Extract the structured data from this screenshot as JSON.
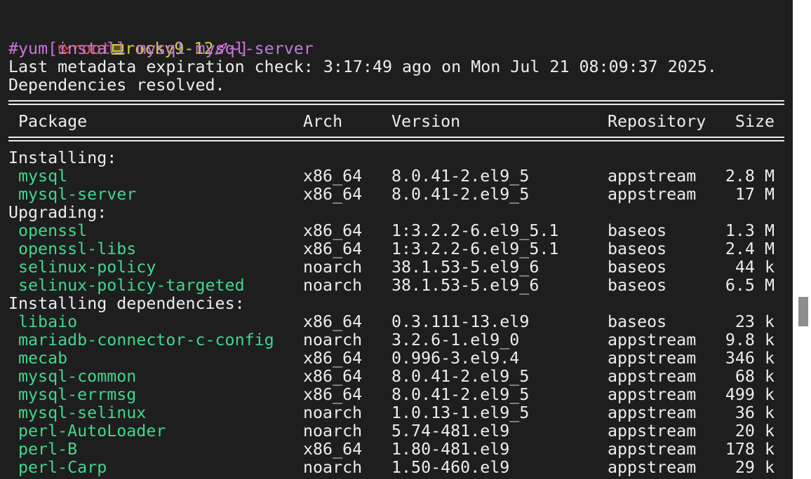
{
  "prompt": {
    "open_bracket": "[",
    "user": "root",
    "host": "rocky9-12",
    "path": "~",
    "close_bracket": "]",
    "user_icon": "crown-icon",
    "host_icon": "computer-icon",
    "path_icon": "rocket-icon"
  },
  "command": "#yum install mysql mysql-server",
  "output_lines": [
    "Last metadata expiration check: 3:17:49 ago on Mon Jul 21 08:09:37 2025.",
    "Dependencies resolved."
  ],
  "table": {
    "headers": {
      "package": "Package",
      "arch": "Arch",
      "version": "Version",
      "repository": "Repository",
      "size": "Size"
    },
    "sections": [
      {
        "title": "Installing:",
        "rows": [
          {
            "name": "mysql",
            "arch": "x86_64",
            "version": "8.0.41-2.el9_5",
            "repo": "appstream",
            "size": "2.8 M"
          },
          {
            "name": "mysql-server",
            "arch": "x86_64",
            "version": "8.0.41-2.el9_5",
            "repo": "appstream",
            "size": "17 M"
          }
        ]
      },
      {
        "title": "Upgrading:",
        "rows": [
          {
            "name": "openssl",
            "arch": "x86_64",
            "version": "1:3.2.2-6.el9_5.1",
            "repo": "baseos",
            "size": "1.3 M"
          },
          {
            "name": "openssl-libs",
            "arch": "x86_64",
            "version": "1:3.2.2-6.el9_5.1",
            "repo": "baseos",
            "size": "2.4 M"
          },
          {
            "name": "selinux-policy",
            "arch": "noarch",
            "version": "38.1.53-5.el9_6",
            "repo": "baseos",
            "size": "44 k"
          },
          {
            "name": "selinux-policy-targeted",
            "arch": "noarch",
            "version": "38.1.53-5.el9_6",
            "repo": "baseos",
            "size": "6.5 M"
          }
        ]
      },
      {
        "title": "Installing dependencies:",
        "rows": [
          {
            "name": "libaio",
            "arch": "x86_64",
            "version": "0.3.111-13.el9",
            "repo": "baseos",
            "size": "23 k"
          },
          {
            "name": "mariadb-connector-c-config",
            "arch": "noarch",
            "version": "3.2.6-1.el9_0",
            "repo": "appstream",
            "size": "9.8 k"
          },
          {
            "name": "mecab",
            "arch": "x86_64",
            "version": "0.996-3.el9.4",
            "repo": "appstream",
            "size": "346 k"
          },
          {
            "name": "mysql-common",
            "arch": "x86_64",
            "version": "8.0.41-2.el9_5",
            "repo": "appstream",
            "size": "68 k"
          },
          {
            "name": "mysql-errmsg",
            "arch": "x86_64",
            "version": "8.0.41-2.el9_5",
            "repo": "appstream",
            "size": "499 k"
          },
          {
            "name": "mysql-selinux",
            "arch": "noarch",
            "version": "1.0.13-1.el9_5",
            "repo": "appstream",
            "size": "36 k"
          },
          {
            "name": "perl-AutoLoader",
            "arch": "noarch",
            "version": "5.74-481.el9",
            "repo": "appstream",
            "size": "20 k"
          },
          {
            "name": "perl-B",
            "arch": "x86_64",
            "version": "1.80-481.el9",
            "repo": "appstream",
            "size": "178 k"
          },
          {
            "name": "perl-Carp",
            "arch": "noarch",
            "version": "1.50-460.el9",
            "repo": "appstream",
            "size": "29 k"
          }
        ]
      }
    ]
  },
  "colors": {
    "background": "#1e1e1e",
    "text": "#ededed",
    "package_name": "#3fd78c",
    "command": "#c777d9",
    "prompt_bracket": "#d070d8",
    "prompt_user": "#ea5252",
    "prompt_host": "#cfd23a"
  }
}
